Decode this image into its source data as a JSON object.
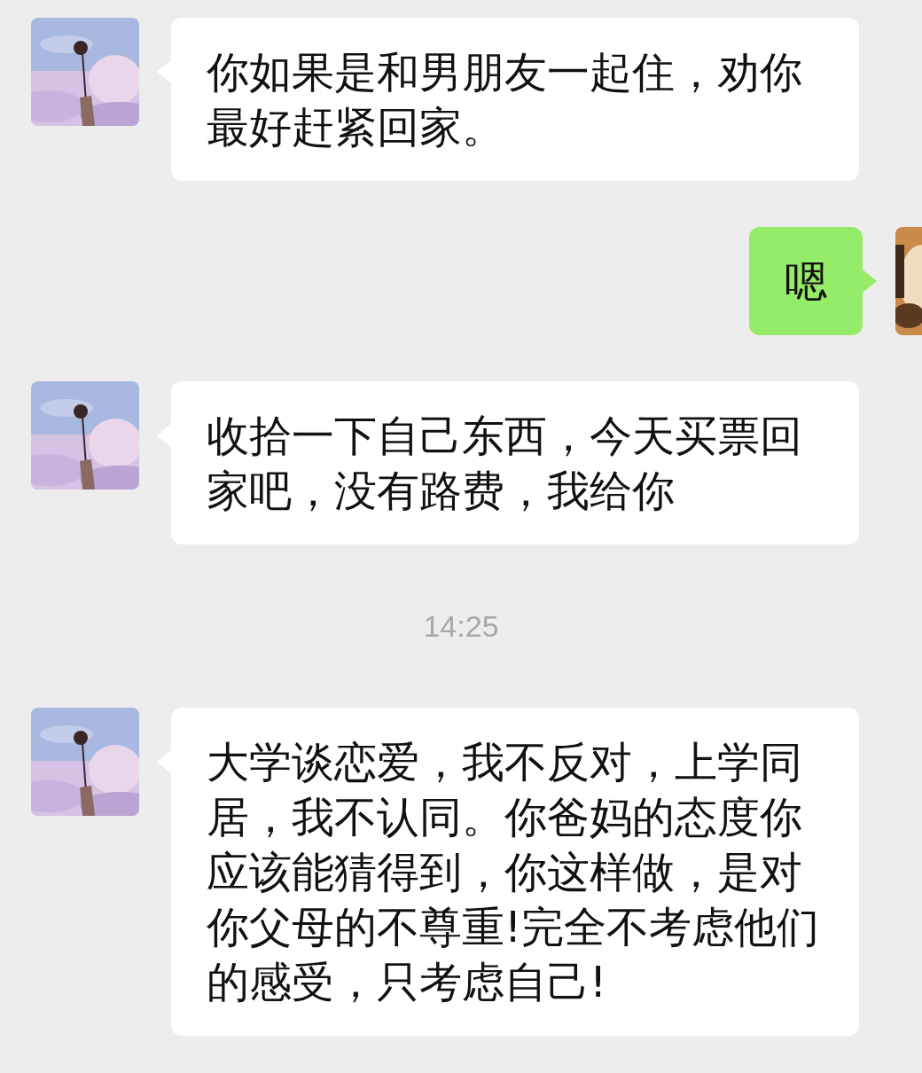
{
  "messages": [
    {
      "kind": "text",
      "outgoing": false,
      "text": "你如果是和男朋友一起住，劝你最好赶紧回家。"
    },
    {
      "kind": "text",
      "outgoing": true,
      "text": "嗯"
    },
    {
      "kind": "text",
      "outgoing": false,
      "text": "收拾一下自己东西，今天买票回家吧，没有路费，我给你"
    },
    {
      "kind": "time",
      "text": "14:25"
    },
    {
      "kind": "text",
      "outgoing": false,
      "text": "大学谈恋爱，我不反对，上学同居，我不认同。你爸妈的态度你应该能猜得到，你这样做，是对你父母的不尊重!完全不考虑他们的感受，只考虑自己!"
    }
  ]
}
